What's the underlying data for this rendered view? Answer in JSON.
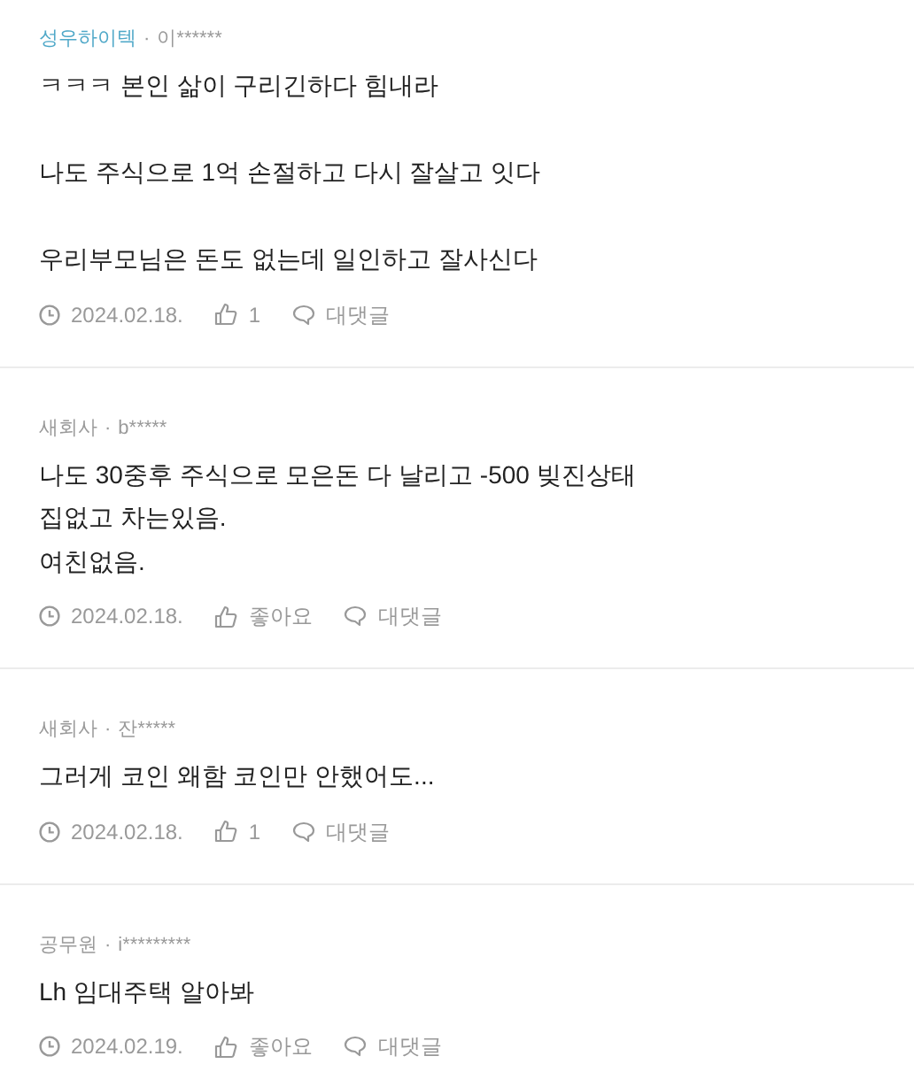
{
  "comments": [
    {
      "company": "성우하이텍",
      "separator": "·",
      "user": "이******",
      "highlighted": true,
      "paragraphs": [
        [
          "ㅋㅋㅋ 본인 삶이 구리긴하다 힘내라"
        ],
        [
          "나도 주식으로 1억 손절하고 다시 잘살고 잇다"
        ],
        [
          "우리부모님은 돈도 없는데 일인하고 잘사신다"
        ]
      ],
      "date": "2024.02.18.",
      "likes": "1",
      "reply": "대댓글"
    },
    {
      "company": "새회사",
      "separator": "·",
      "user": "b*****",
      "highlighted": false,
      "paragraphs": [
        [
          "나도 30중후 주식으로 모은돈 다 날리고 -500 빚진상태",
          "집없고 차는있음.",
          "여친없음."
        ]
      ],
      "date": "2024.02.18.",
      "likes": "좋아요",
      "reply": "대댓글"
    },
    {
      "company": "새회사",
      "separator": "·",
      "user": "잔*****",
      "highlighted": false,
      "paragraphs": [
        [
          "그러게 코인 왜함 코인만 안했어도..."
        ]
      ],
      "date": "2024.02.18.",
      "likes": "1",
      "reply": "대댓글"
    },
    {
      "company": "공무원",
      "separator": "·",
      "user": "i*********",
      "highlighted": false,
      "paragraphs": [
        [
          "Lh 임대주택 알아봐"
        ]
      ],
      "date": "2024.02.19.",
      "likes": "좋아요",
      "reply": "대댓글"
    }
  ]
}
